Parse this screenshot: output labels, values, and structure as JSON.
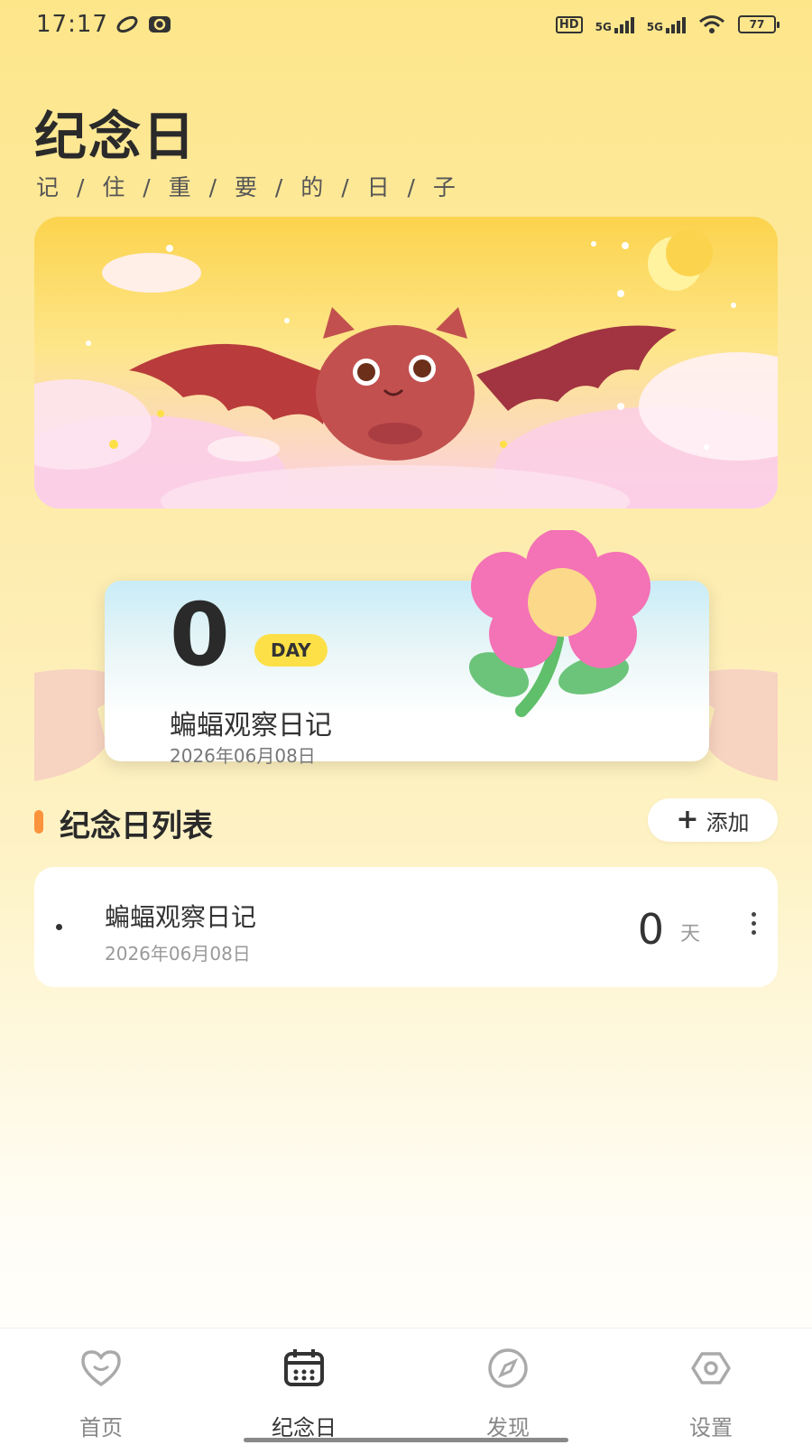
{
  "status_bar": {
    "time": "17:17",
    "network_label_1": "5G",
    "network_label_2": "5G",
    "hd_label": "HD",
    "battery": "77"
  },
  "header": {
    "title": "纪念日",
    "subtitle": "记 / 住 / 重 / 要 / 的 / 日 / 子"
  },
  "hero": {
    "count": "0",
    "unit_badge": "DAY",
    "name": "蝙蝠观察日记",
    "date": "2026年06月08日"
  },
  "section": {
    "title": "纪念日列表",
    "add_label": "添加",
    "add_icon": "plus-icon"
  },
  "list": [
    {
      "name": "蝙蝠观察日记",
      "date": "2026年06月08日",
      "count": "0",
      "unit": "天"
    }
  ],
  "nav": {
    "items": [
      {
        "label": "首页",
        "icon": "heart-face-icon",
        "active": false
      },
      {
        "label": "纪念日",
        "icon": "calendar-icon",
        "active": true
      },
      {
        "label": "发现",
        "icon": "compass-icon",
        "active": false
      },
      {
        "label": "设置",
        "icon": "settings-hexagon-icon",
        "active": false
      }
    ]
  },
  "colors": {
    "accent": "#fb923c",
    "badge": "#fde047",
    "background_top": "#fde68a"
  }
}
